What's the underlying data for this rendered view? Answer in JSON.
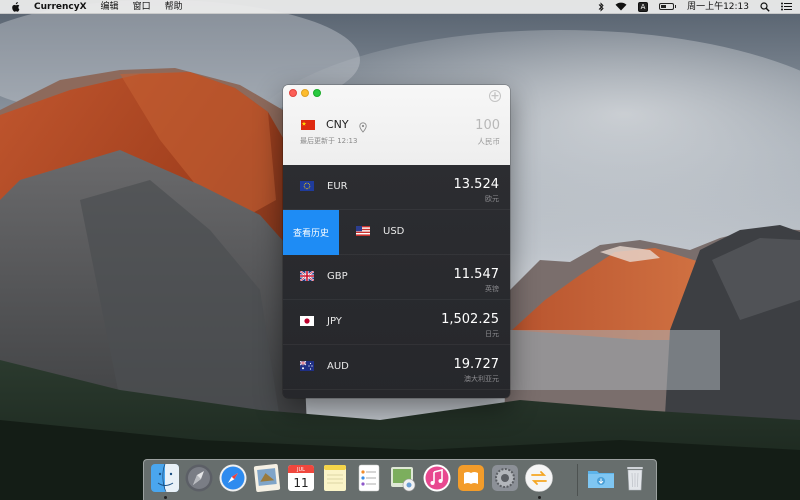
{
  "menubar": {
    "app_name": "CurrencyX",
    "menus": [
      "编辑",
      "窗口",
      "帮助"
    ],
    "clock": "周一上午12:13",
    "status_icons": [
      "bluetooth-icon",
      "wifi-icon",
      "input-source-icon",
      "battery-icon",
      "search-icon",
      "notification-center-icon"
    ],
    "input_source_label": "A"
  },
  "window": {
    "base_currency": {
      "code": "CNY",
      "amount": "100",
      "name": "人民币",
      "updated": "最后更新于 12:13"
    },
    "swipe_action_label": "查看历史",
    "rates": [
      {
        "code": "EUR",
        "amount": "13.524",
        "name": "欧元"
      },
      {
        "code": "USD",
        "amount": "",
        "name": ""
      },
      {
        "code": "GBP",
        "amount": "11.547",
        "name": "英镑"
      },
      {
        "code": "JPY",
        "amount": "1,502.25",
        "name": "日元"
      },
      {
        "code": "AUD",
        "amount": "19.727",
        "name": "澳大利亚元"
      }
    ]
  },
  "dock": {
    "apps": [
      "finder-icon",
      "launchpad-icon",
      "safari-icon",
      "mail-icon",
      "calendar-icon",
      "notes-icon",
      "reminders-icon",
      "photos-icon",
      "itunes-icon",
      "ibooks-icon",
      "system-preferences-icon",
      "currencyx-icon",
      "downloads-folder-icon",
      "trash-icon"
    ],
    "calendar_month": "JUL",
    "calendar_day": "11"
  },
  "colors": {
    "accent": "#1e8cf5",
    "list_background": "#2a2b2f",
    "titlebar": "#f2f2f2"
  }
}
